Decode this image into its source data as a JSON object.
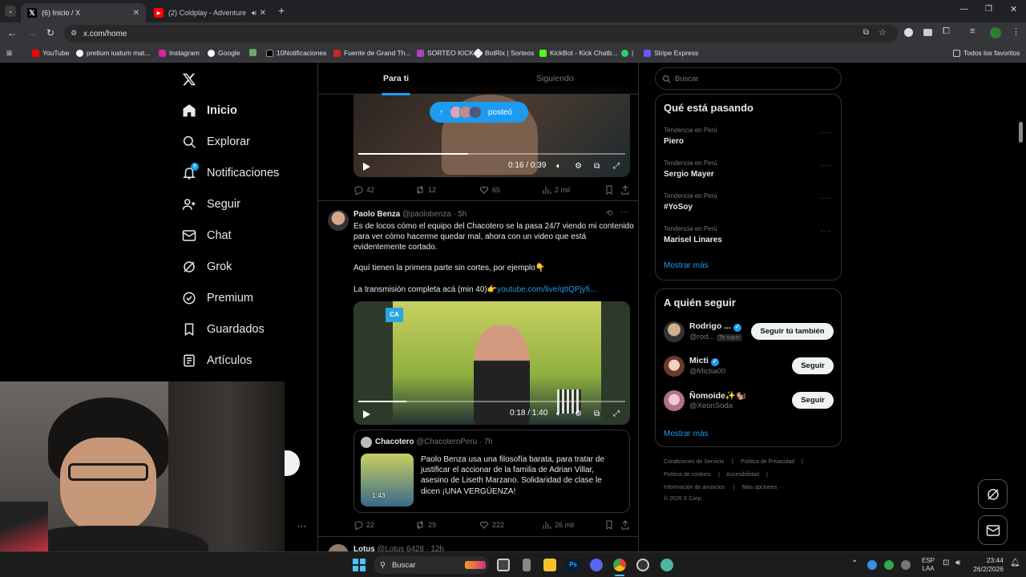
{
  "browser": {
    "tabs": [
      {
        "title": "(6) Inicio / X",
        "close": "✕"
      },
      {
        "title": "(2) Coldplay - Adventure Of",
        "close": "✕"
      }
    ],
    "new_tab": "+",
    "url": "x.com/home",
    "bookmarks": [
      "YouTube",
      "pretium iustum mat...",
      "Instagram",
      "Google",
      "",
      "10Notificaciones",
      "Fuente de Grand Th...",
      "SORTEO KICK",
      "BotRix | Sorteos",
      "KickBot - Kick Chatb...",
      "|",
      "Stripe Express"
    ],
    "all_bookmarks": "Todos los favoritos"
  },
  "nav": {
    "items": [
      "Inicio",
      "Explorar",
      "Notificaciones",
      "Seguir",
      "Chat",
      "Grok",
      "Premium",
      "Guardados",
      "Artículos"
    ],
    "notif_badge": "6",
    "more_dots": "···"
  },
  "feed": {
    "tabs": [
      "Para ti",
      "Siguiendo"
    ],
    "posted_pill": "posteó",
    "video1": {
      "time": "0:16 / 0:39",
      "progress": 0.41
    },
    "post1_stats": {
      "replies": "42",
      "reposts": "12",
      "likes": "65",
      "views": "2 mil"
    },
    "post2": {
      "name": "Paolo Benza",
      "handle": "@paolobenza · 5h",
      "text1": "Es de locos cómo el equipo del Chacotero se la pasa 24/7 viendo mi contenido para ver cómo hacerme quedar mal, ahora con un video que está evidentemente cortado.",
      "text2": "Aquí tienen la primera parte sin cortes, por ejemplo👇",
      "text3": "La transmisión completa acá (min 40)👉",
      "link": "youtube.com/live/qtIQPjyfi...",
      "video_time": "0:18 / 1:40",
      "video_progress": 0.18,
      "quote": {
        "name": "Chacotero",
        "handle": "@ChacoteroPeru · 7h",
        "text": "Paolo Benza usa una filosofía barata, para tratar de justificar el accionar de la familia de Adrian Villar, asesino de Liseth Marzano. Solidaridad de clase le dicen ¡UNA VERGÜENZA!",
        "thumb_time": "1:43"
      },
      "stats": {
        "replies": "22",
        "reposts": "29",
        "likes": "222",
        "views": "26 mil"
      }
    },
    "post3": {
      "name": "Lotus",
      "handle": "@Lotus 6428 · 12h"
    }
  },
  "right": {
    "search_placeholder": "Buscar",
    "trending_title": "Qué está pasando",
    "trends": [
      {
        "label": "Tendencia en Perú",
        "name": "Piero"
      },
      {
        "label": "Tendencia en Perú",
        "name": "Sergio Mayer"
      },
      {
        "label": "Tendencia en Perú",
        "name": "#YoSoy"
      },
      {
        "label": "Tendencia en Perú",
        "name": "Marisel Linares"
      }
    ],
    "show_more": "Mostrar más",
    "follow_title": "A quién seguir",
    "follows": [
      {
        "name": "Rodrigo ...",
        "handle": "@rod...",
        "badge": "Te sigue",
        "button": "Seguir tú también"
      },
      {
        "name": "Micti",
        "handle": "@Mictia00",
        "button": "Seguir"
      },
      {
        "name": "Ñomoide✨🐿️",
        "handle": "@XeonSoda",
        "button": "Seguir"
      }
    ],
    "show_more2": "Mostrar más",
    "footer": [
      "Condiciones de Servicio",
      "Política de Privacidad",
      "Política de cookies",
      "Accesibilidad",
      "Información de anuncios",
      "Más opciones ···",
      "© 2026 X Corp."
    ]
  },
  "taskbar": {
    "search": "Buscar",
    "lang1": "ESP",
    "lang2": "LAA",
    "time": "23:44",
    "date": "26/2/2026"
  },
  "colors": {
    "accent": "#1d9bf0",
    "bg": "#000000",
    "border": "#2f3336",
    "muted": "#71767b"
  }
}
